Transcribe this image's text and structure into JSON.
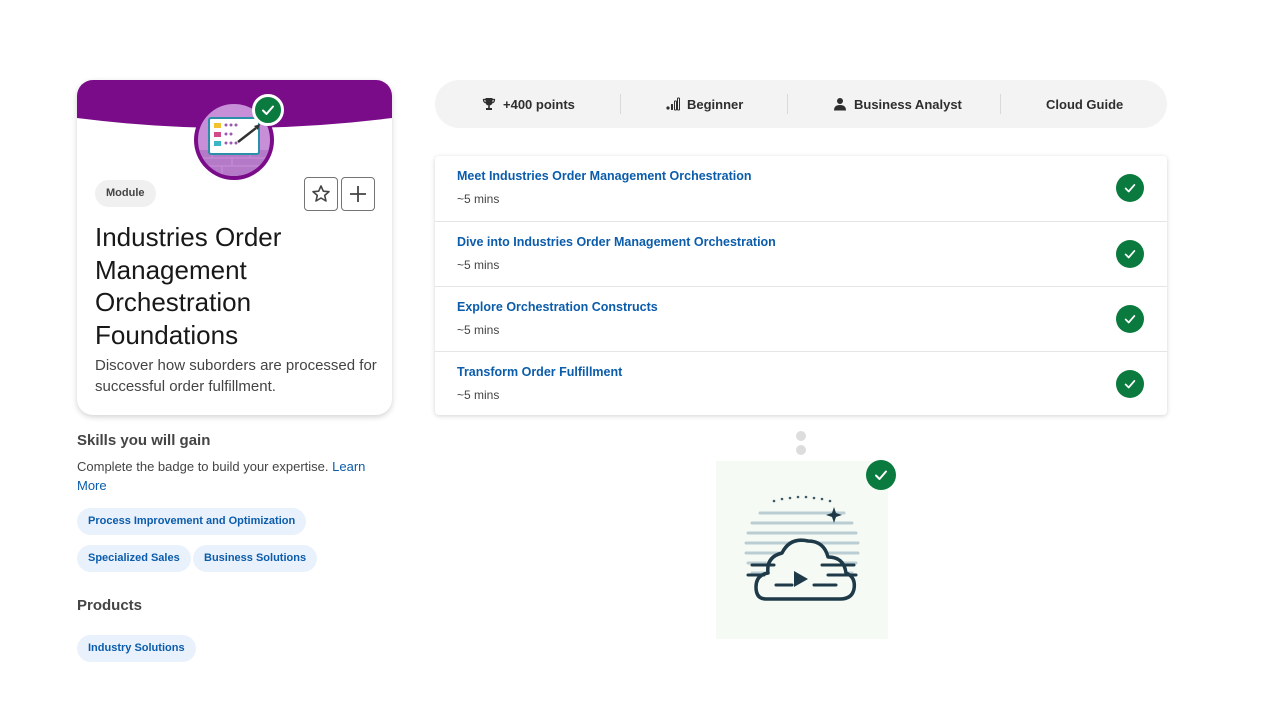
{
  "module": {
    "badge": "Module",
    "title": "Industries Order Management Orchestration Foundations",
    "description": "Discover how suborders are processed for successful order fulfillment.",
    "banner_color": "#7a0c8a",
    "icon": "order-dashboard-icon"
  },
  "skills": {
    "heading": "Skills you will gain",
    "note": "Complete the badge to build your expertise.",
    "learn_more": "Learn More",
    "items": [
      "Process Improvement and Optimization",
      "Specialized Sales",
      "Business Solutions"
    ]
  },
  "products": {
    "heading": "Products",
    "items": [
      "Industry Solutions"
    ]
  },
  "stats": {
    "points": "+400 points",
    "level": "Beginner",
    "role": "Business Analyst",
    "guide": "Cloud Guide"
  },
  "units": [
    {
      "title": "Meet Industries Order Management Orchestration",
      "time": "~5 mins",
      "completed": true
    },
    {
      "title": "Dive into Industries Order Management Orchestration",
      "time": "~5 mins",
      "completed": true
    },
    {
      "title": "Explore Orchestration Constructs",
      "time": "~5 mins",
      "completed": true
    },
    {
      "title": "Transform Order Fulfillment",
      "time": "~5 mins",
      "completed": true
    }
  ],
  "badge": {
    "icon": "cloud-play-icon",
    "completed": true
  },
  "colors": {
    "accent": "#0b5cab",
    "success": "#0b7a3e",
    "module_purple": "#7a0c8a"
  }
}
